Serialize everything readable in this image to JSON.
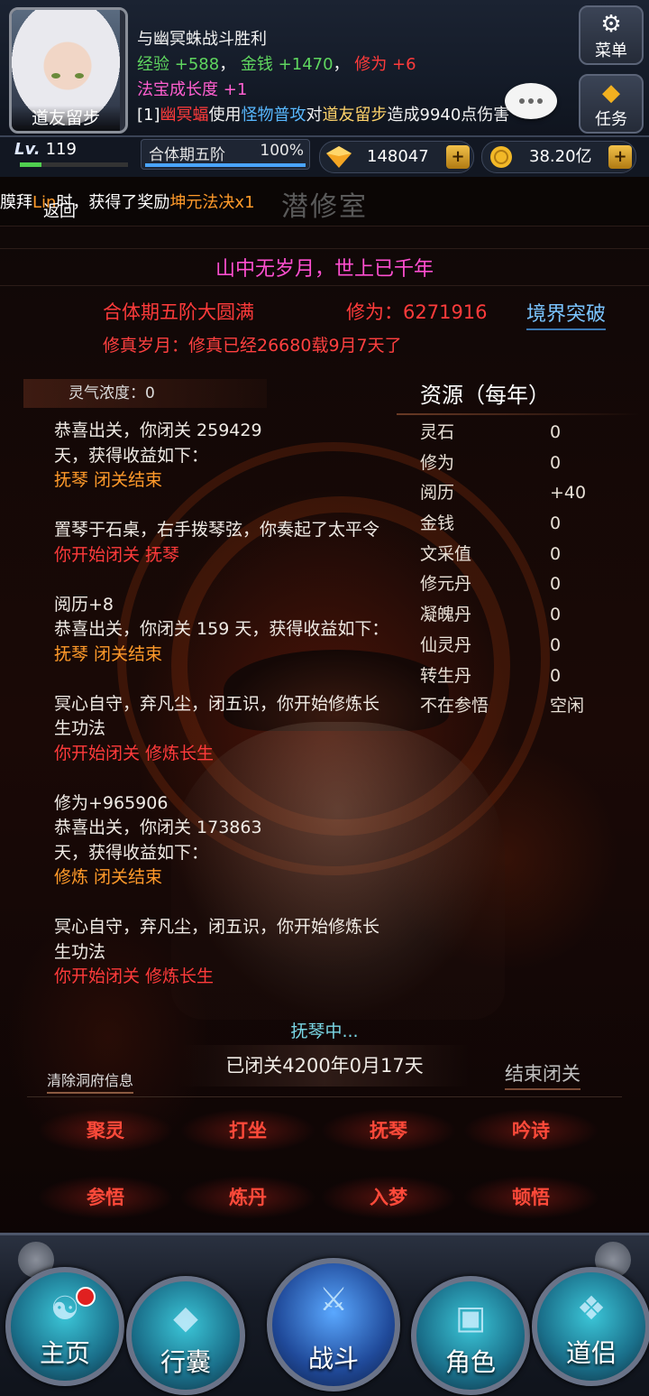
{
  "player": {
    "name": "道友留步",
    "level_prefix": "Lv.",
    "level": "119",
    "level_progress": 0.2,
    "realm": "合体期五阶",
    "realm_progress": "100%"
  },
  "header_messages": {
    "battle_title": "与幽冥蛛战斗胜利",
    "exp_label": "经验",
    "exp_value": "+588",
    "sep1": "，",
    "money_label": "金钱",
    "money_value": "+1470",
    "sep2": "，",
    "cultivation_label": "修为",
    "cultivation_value": "+6",
    "treasure_label": "法宝成长度",
    "treasure_value": "+1",
    "combat_prefix": "[1]",
    "combat_monster": "幽冥蝠",
    "combat_use": "使用",
    "combat_skill": "怪物普攻",
    "combat_to": "对",
    "combat_target": "道友留步",
    "combat_result": "造成9940点伤害"
  },
  "side_buttons": {
    "menu": "菜单",
    "task": "任务"
  },
  "currencies": {
    "gems": "148047",
    "gold": "38.20亿"
  },
  "marquee": {
    "prefix": "膜拜",
    "name": "Lin",
    "middle": "时，获得了奖励",
    "reward": "坤元法决x1"
  },
  "room": {
    "back": "返回",
    "title": "潜修室",
    "slogan": "山中无岁月，世上已千年",
    "realm_state": "合体期五阶大圆满",
    "cultivation": "修为：6271916",
    "breakthrough": "境界突破",
    "years": "修真岁月：修真已经26680载9月7天了",
    "qi_label": "灵气浓度：0"
  },
  "resources": {
    "title": "资源（每年）",
    "rows": [
      {
        "k": "灵石",
        "v": "0"
      },
      {
        "k": "修为",
        "v": "0"
      },
      {
        "k": "阅历",
        "v": "+40"
      },
      {
        "k": "金钱",
        "v": "0"
      },
      {
        "k": "文采值",
        "v": "0"
      },
      {
        "k": "修元丹",
        "v": "0"
      },
      {
        "k": "凝魄丹",
        "v": "0"
      },
      {
        "k": "仙灵丹",
        "v": "0"
      },
      {
        "k": "转生丹",
        "v": "0"
      },
      {
        "k": "不在参悟",
        "v": "空闲"
      }
    ]
  },
  "log": [
    {
      "t": "plain",
      "text": "恭喜出关，你闭关 259429"
    },
    {
      "t": "plain",
      "text": "天，获得收益如下："
    },
    {
      "t": "orange",
      "text": "抚琴 闭关结束"
    },
    {
      "t": "gap",
      "text": ""
    },
    {
      "t": "plain",
      "text": "置琴于石桌，右手拨琴弦，你奏起了太平令"
    },
    {
      "t": "red",
      "text": "你开始闭关 抚琴"
    },
    {
      "t": "gap",
      "text": ""
    },
    {
      "t": "plain",
      "text": "阅历+8"
    },
    {
      "t": "plain",
      "text": "恭喜出关，你闭关 159 天，获得收益如下："
    },
    {
      "t": "orange",
      "text": "抚琴 闭关结束"
    },
    {
      "t": "gap",
      "text": ""
    },
    {
      "t": "plain",
      "text": "冥心自守，弃凡尘，闭五识，你开始修炼长"
    },
    {
      "t": "plain",
      "text": "生功法"
    },
    {
      "t": "red",
      "text": "你开始闭关 修炼长生"
    },
    {
      "t": "gap",
      "text": ""
    },
    {
      "t": "plain",
      "text": "修为+965906"
    },
    {
      "t": "plain",
      "text": "恭喜出关，你闭关 173863"
    },
    {
      "t": "plain",
      "text": "天，获得收益如下："
    },
    {
      "t": "orange",
      "text": "修炼 闭关结束"
    },
    {
      "t": "gap",
      "text": ""
    },
    {
      "t": "plain",
      "text": "冥心自守，弃凡尘，闭五识，你开始修炼长"
    },
    {
      "t": "plain",
      "text": "生功法"
    },
    {
      "t": "red",
      "text": "你开始闭关 修炼长生"
    }
  ],
  "status": {
    "current": "抚琴中...",
    "closed_time": "已闭关4200年0月17天",
    "clear_info": "清除洞府信息",
    "end_closed": "结束闭关"
  },
  "actions": [
    "聚灵",
    "打坐",
    "抚琴",
    "吟诗",
    "参悟",
    "炼丹",
    "入梦",
    "顿悟"
  ],
  "nav": {
    "home": "主页",
    "bag": "行囊",
    "battle": "战斗",
    "role": "角色",
    "partner": "道侣"
  }
}
